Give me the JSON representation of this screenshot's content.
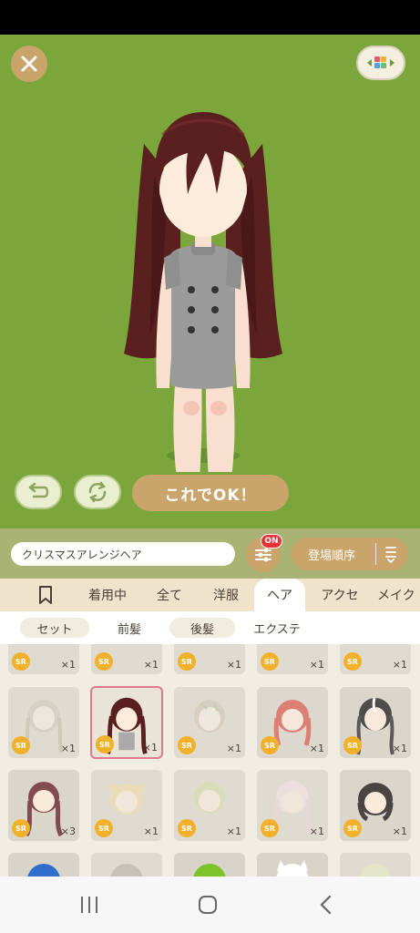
{
  "search": {
    "value": "クリスマスアレンジヘア"
  },
  "filter": {
    "badge": "ON"
  },
  "sort": {
    "label": "登場順序"
  },
  "ok_button": {
    "label": "これでOK！"
  },
  "tabs": [
    {
      "label": "着用中"
    },
    {
      "label": "全て"
    },
    {
      "label": "洋服"
    },
    {
      "label": "ヘア"
    },
    {
      "label": "アクセ"
    },
    {
      "label": "メイク"
    }
  ],
  "subtabs": [
    {
      "label": "セット"
    },
    {
      "label": "前髪"
    },
    {
      "label": "後髪"
    },
    {
      "label": "エクステ"
    }
  ],
  "items": [
    {
      "rarity": "SR",
      "count": "×1"
    },
    {
      "rarity": "SR",
      "count": "×1"
    },
    {
      "rarity": "SR",
      "count": "×1"
    },
    {
      "rarity": "SR",
      "count": "×1"
    },
    {
      "rarity": "SR",
      "count": "×1"
    },
    {
      "rarity": "SR",
      "count": "×1"
    },
    {
      "rarity": "SR",
      "count": "×1"
    },
    {
      "rarity": "SR",
      "count": "×1"
    },
    {
      "rarity": "SR",
      "count": "×1"
    },
    {
      "rarity": "SR",
      "count": "×1"
    },
    {
      "rarity": "SR",
      "count": "×3"
    },
    {
      "rarity": "SR",
      "count": "×1"
    },
    {
      "rarity": "SR",
      "count": "×1"
    },
    {
      "rarity": "SR",
      "count": "×1"
    },
    {
      "rarity": "SR",
      "count": "×1"
    }
  ],
  "colors": {
    "stage_bg": "#7aa63c",
    "accent": "#c9a46b",
    "hair": "#5a1f1f",
    "badge_red": "#e5333c",
    "sr_gold": "#f2b12a"
  }
}
